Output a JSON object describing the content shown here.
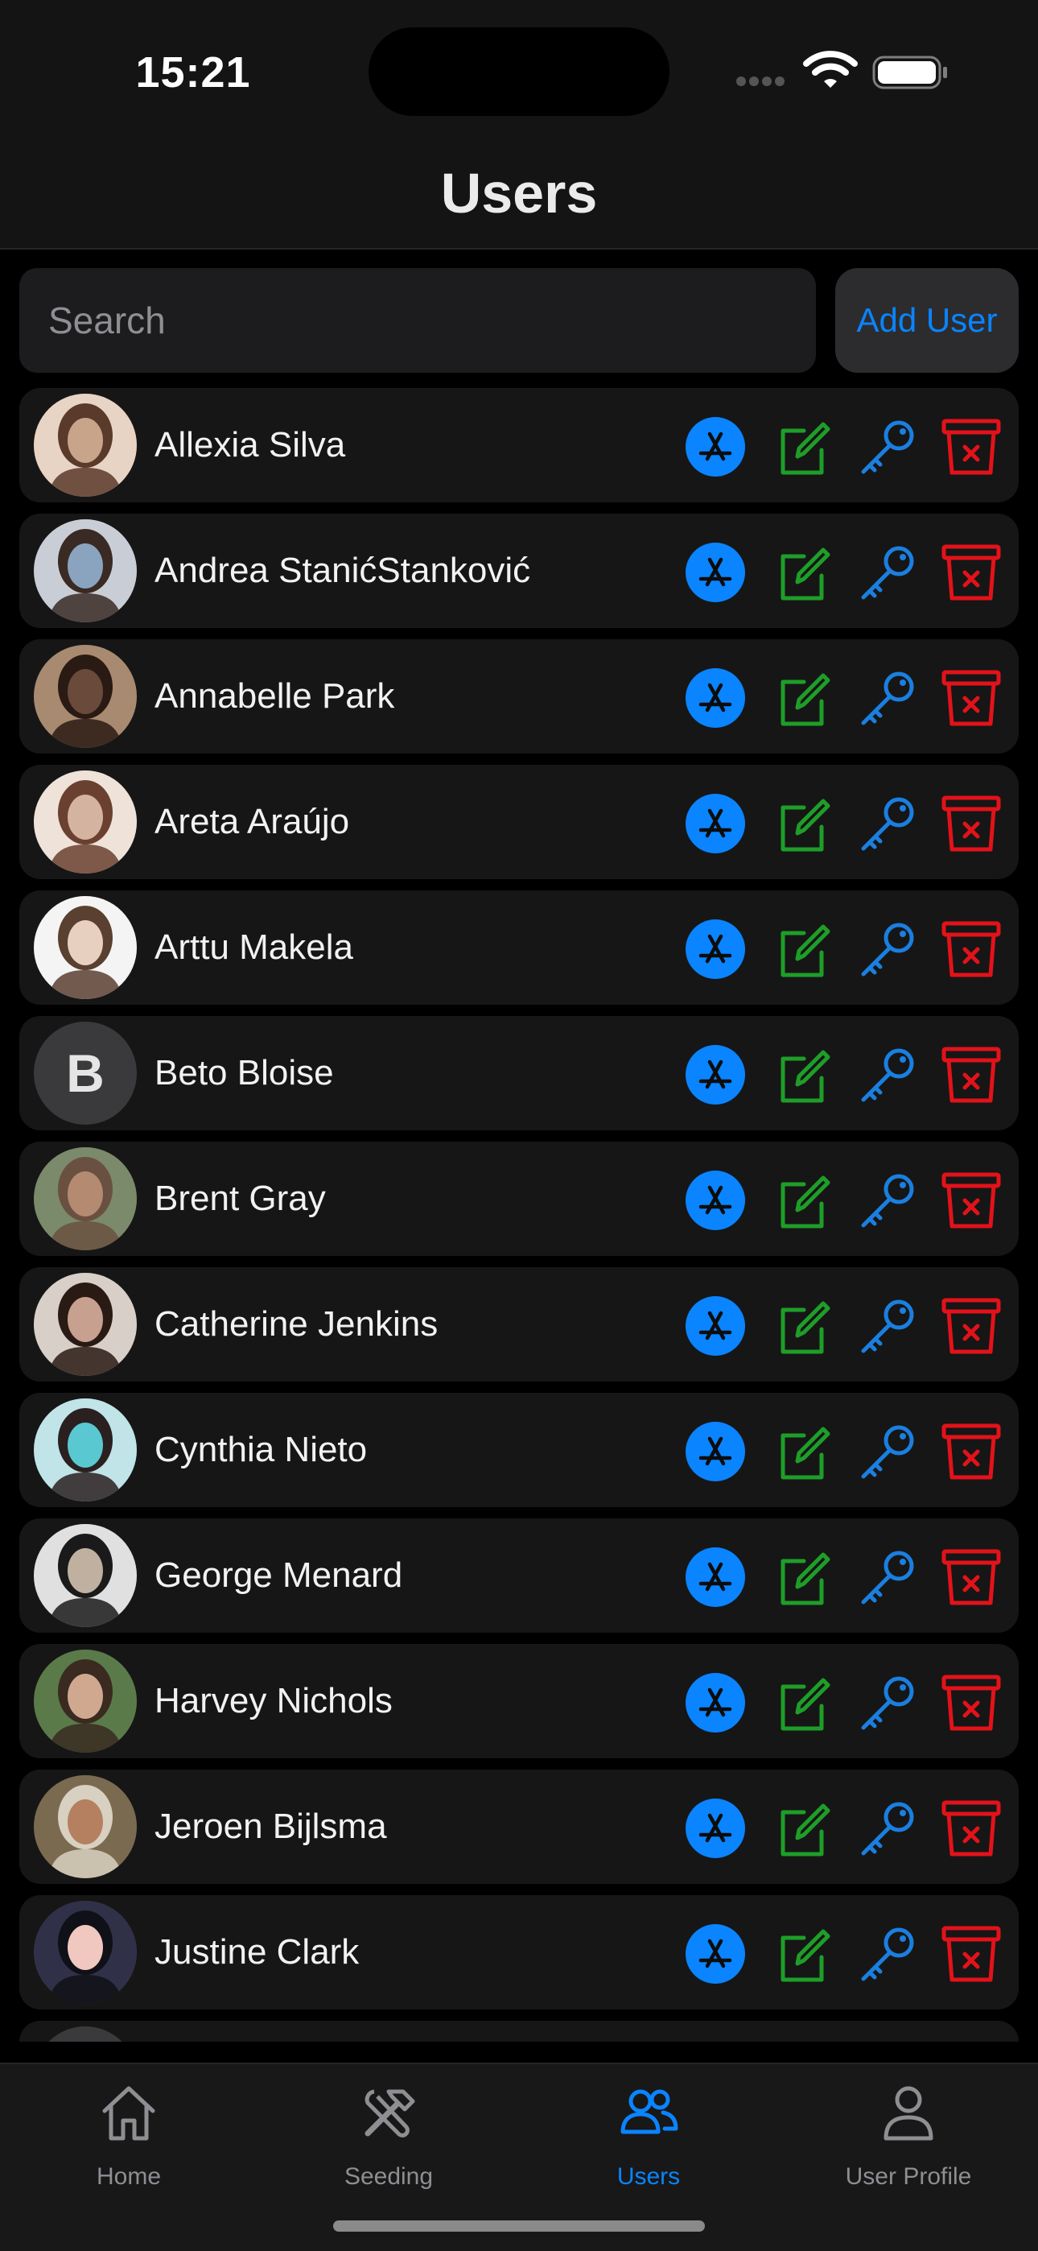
{
  "status_bar": {
    "time": "15:21"
  },
  "header": {
    "title": "Users"
  },
  "search": {
    "placeholder": "Search",
    "value": ""
  },
  "toolbar": {
    "add_user_label": "Add User"
  },
  "users": [
    {
      "name": "Allexia Silva",
      "avatar": "photo"
    },
    {
      "name": "Andrea StanićStanković",
      "avatar": "photo"
    },
    {
      "name": "Annabelle Park",
      "avatar": "photo"
    },
    {
      "name": "Areta Araújo",
      "avatar": "photo"
    },
    {
      "name": "Arttu Makela",
      "avatar": "photo"
    },
    {
      "name": "Beto Bloise",
      "avatar": "initial",
      "initial": "B"
    },
    {
      "name": "Brent Gray",
      "avatar": "photo"
    },
    {
      "name": "Catherine Jenkins",
      "avatar": "photo"
    },
    {
      "name": "Cynthia Nieto",
      "avatar": "photo"
    },
    {
      "name": "George Menard",
      "avatar": "photo"
    },
    {
      "name": "Harvey Nichols",
      "avatar": "photo"
    },
    {
      "name": "Jeroen Bijlsma",
      "avatar": "photo"
    },
    {
      "name": "Justine Clark",
      "avatar": "photo"
    }
  ],
  "row_actions": [
    {
      "icon": "app-store-icon",
      "color": "#0a84ff"
    },
    {
      "icon": "edit-icon",
      "color": "#1e9e28"
    },
    {
      "icon": "key-icon",
      "color": "#1a7fe0"
    },
    {
      "icon": "trash-icon",
      "color": "#e3121a"
    }
  ],
  "tabbar": {
    "tabs": [
      {
        "label": "Home",
        "icon": "house-icon",
        "active": false
      },
      {
        "label": "Seeding",
        "icon": "hammer-wrench-icon",
        "active": false
      },
      {
        "label": "Users",
        "icon": "people-icon",
        "active": true
      },
      {
        "label": "User Profile",
        "icon": "person-icon",
        "active": false
      }
    ]
  },
  "colors": {
    "accent": "#0a84ff",
    "edit": "#1e9e28",
    "delete": "#e3121a",
    "background": "#000000",
    "row": "#161616"
  }
}
